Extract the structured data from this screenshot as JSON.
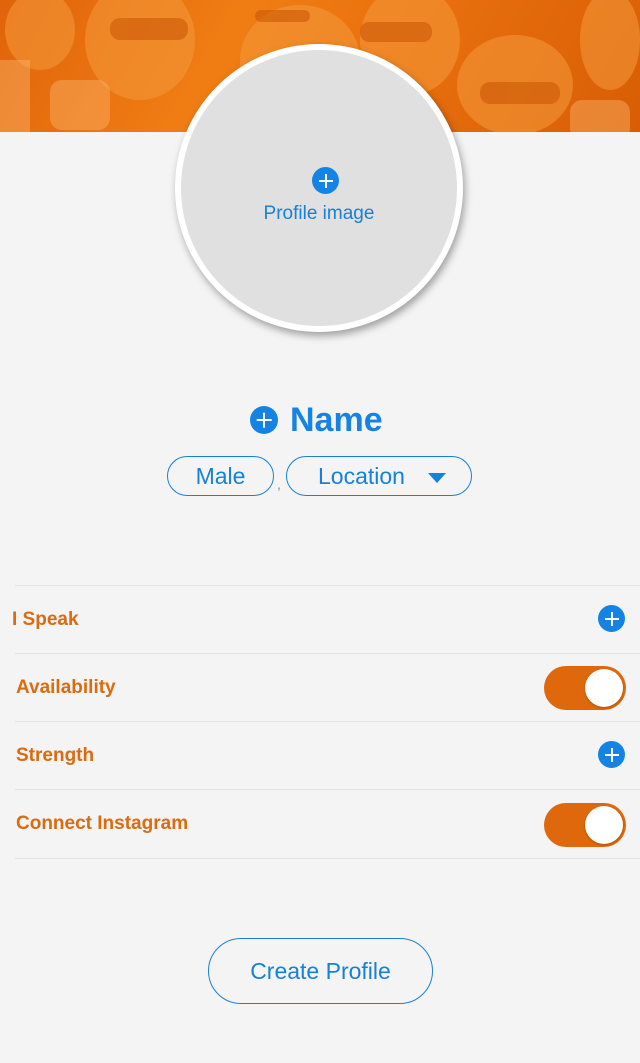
{
  "profile_image": {
    "label": "Profile image"
  },
  "name": {
    "label": "Name"
  },
  "gender": {
    "value": "Male"
  },
  "separator": ",",
  "location": {
    "label": "Location"
  },
  "settings": [
    {
      "label": "I Speak",
      "control": "add"
    },
    {
      "label": "Availability",
      "control": "toggle",
      "on": true
    },
    {
      "label": "Strength",
      "control": "add"
    },
    {
      "label": "Connect Instagram",
      "control": "toggle",
      "on": true
    }
  ],
  "create_button": {
    "label": "Create Profile"
  },
  "colors": {
    "accent_blue": "#1483e4",
    "accent_orange": "#e0680c",
    "background": "#f4f4f4"
  }
}
